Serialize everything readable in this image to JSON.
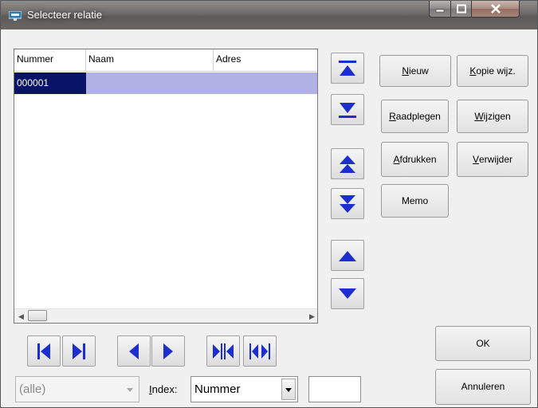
{
  "window": {
    "title": "Selecteer relatie"
  },
  "grid": {
    "columns": [
      "Nummer",
      "Naam",
      "Adres"
    ],
    "rows": [
      {
        "nummer": "000001",
        "naam": "",
        "adres": ""
      }
    ]
  },
  "buttons": {
    "nieuw": {
      "underlined": "N",
      "rest": "ieuw"
    },
    "kopie": {
      "underlined": "K",
      "rest": "opie wijz."
    },
    "raadplegen": {
      "underlined": "R",
      "rest": "aadplegen"
    },
    "wijzigen": {
      "underlined": "W",
      "rest": "ijzigen"
    },
    "afdrukken": {
      "underlined": "A",
      "rest": "fdrukken"
    },
    "verwijder": {
      "underlined": "V",
      "rest": "erwijder"
    },
    "memo": "Memo",
    "ok": "OK",
    "annuleren": "Annuleren"
  },
  "filter": {
    "value": "(alle)",
    "index_label_underlined": "I",
    "index_label_rest": "ndex:",
    "index_value": "Nummer",
    "search_value": ""
  },
  "colors": {
    "selected_key": "#0a1466",
    "selected_row": "#b0b2e6",
    "nav_icon": "#1c2ecf"
  }
}
